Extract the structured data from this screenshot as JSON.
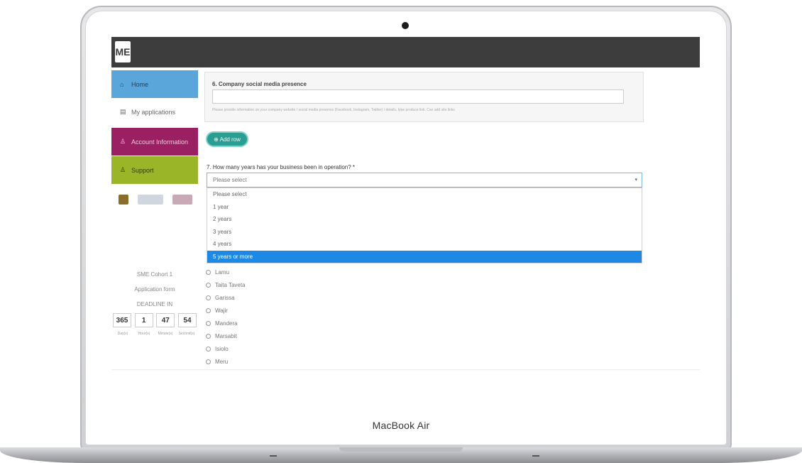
{
  "device": {
    "model_label": "MacBook Air"
  },
  "topbar": {
    "logo_text": "ME"
  },
  "sidebar": {
    "items": [
      {
        "label": "Home",
        "icon": "home-icon",
        "glyph": "⌂"
      },
      {
        "label": "My applications",
        "icon": "document-icon",
        "glyph": "▤"
      },
      {
        "label": "Account Information",
        "icon": "user-icon",
        "glyph": "♙"
      },
      {
        "label": "Support",
        "icon": "support-icon",
        "glyph": "♙"
      }
    ],
    "cohort_name": "SME Cohort 1",
    "application_form": "Application form",
    "deadline_label": "DEADLINE IN",
    "countdown": {
      "days": "365",
      "hours": "1",
      "minutes": "47",
      "seconds": "54",
      "days_label": "Day(s)",
      "hours_label": "Hour(s)",
      "minutes_label": "Minute(s)",
      "seconds_label": "Second(s)"
    }
  },
  "main": {
    "q6": {
      "title": "6. Company social media presence",
      "value": "",
      "help": "Please provide information on your company website / social media presence (Facebook, Instagram, Twitter) / details, type produce link. Can add  site links"
    },
    "add_row_label": "⊕ Add row",
    "q7": {
      "title": "7. How many years has your business been in operation? *",
      "selected_value": "Please select",
      "options": [
        "Please select",
        "1 year",
        "2 years",
        "3 years",
        "4 years",
        "5 years or more"
      ],
      "highlighted_index": 5
    },
    "radio_options": [
      "Lamu",
      "Taita Taveta",
      "Garissa",
      "Wajir",
      "Mandera",
      "Marsabit",
      "Isiolo",
      "Meru"
    ]
  },
  "colors": {
    "topbar": "#3d3d3d",
    "home": "#5aa6db",
    "account": "#9a1f63",
    "support": "#9bb529",
    "add_row": "#2b9e94",
    "dropdown_highlight": "#1e88e5"
  }
}
